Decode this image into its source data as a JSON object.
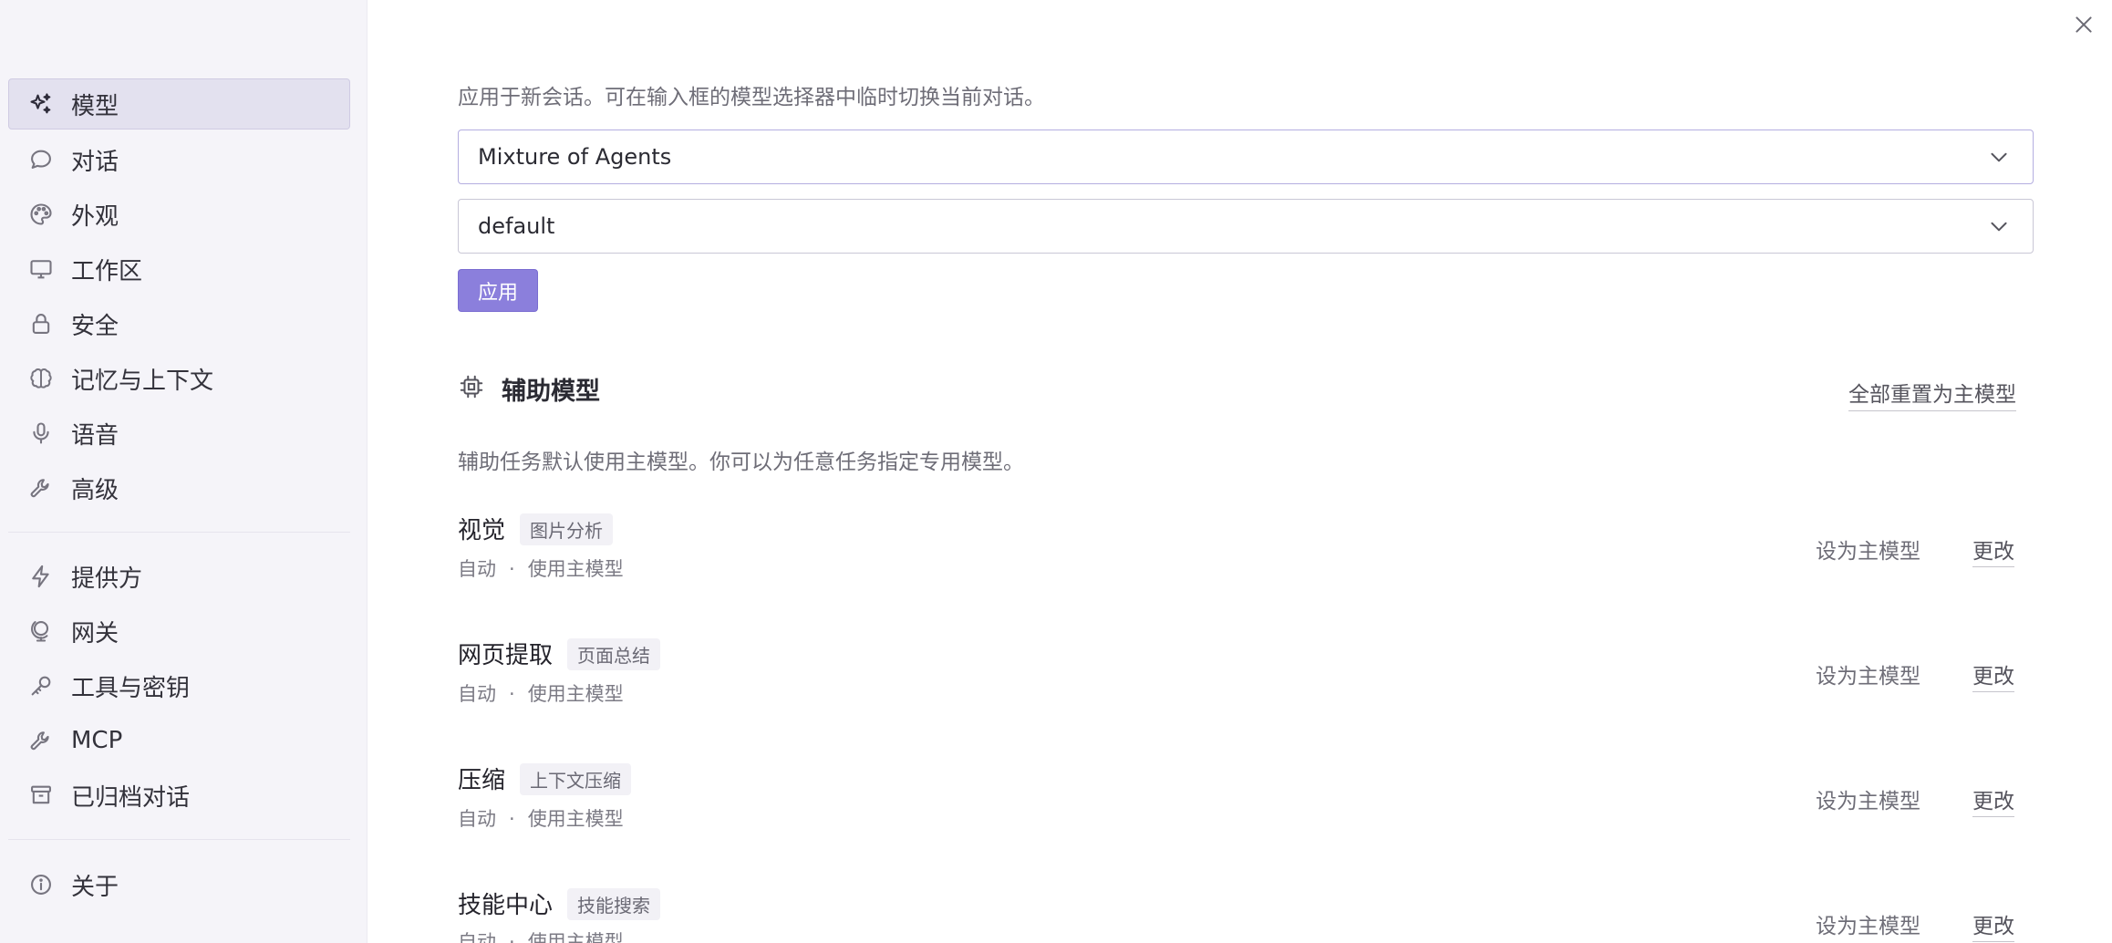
{
  "sidebar": {
    "items": [
      {
        "label": "模型",
        "icon": "sparkles-icon"
      },
      {
        "label": "对话",
        "icon": "chat-bubble-icon"
      },
      {
        "label": "外观",
        "icon": "palette-icon"
      },
      {
        "label": "工作区",
        "icon": "monitor-icon"
      },
      {
        "label": "安全",
        "icon": "lock-icon"
      },
      {
        "label": "记忆与上下文",
        "icon": "brain-icon"
      },
      {
        "label": "语音",
        "icon": "microphone-icon"
      },
      {
        "label": "高级",
        "icon": "wrench-icon"
      },
      {
        "label": "提供方",
        "icon": "lightning-icon"
      },
      {
        "label": "网关",
        "icon": "globe-icon"
      },
      {
        "label": "工具与密钥",
        "icon": "key-icon"
      },
      {
        "label": "MCP",
        "icon": "wrench-icon"
      },
      {
        "label": "已归档对话",
        "icon": "archive-icon"
      },
      {
        "label": "关于",
        "icon": "info-icon"
      }
    ],
    "active": "模型"
  },
  "main": {
    "description": "应用于新会话。可在输入框的模型选择器中临时切换当前对话。",
    "model_select": {
      "value": "Mixture of Agents"
    },
    "profile_select": {
      "value": "default"
    },
    "apply_label": "应用",
    "aux": {
      "title": "辅助模型",
      "reset_label": "全部重置为主模型",
      "description": "辅助任务默认使用主模型。你可以为任意任务指定专用模型。",
      "tasks": [
        {
          "name": "视觉",
          "tag": "图片分析",
          "status": "自动",
          "sep": "·",
          "model": "使用主模型",
          "set_main": "设为主模型",
          "change": "更改"
        },
        {
          "name": "网页提取",
          "tag": "页面总结",
          "status": "自动",
          "sep": "·",
          "model": "使用主模型",
          "set_main": "设为主模型",
          "change": "更改"
        },
        {
          "name": "压缩",
          "tag": "上下文压缩",
          "status": "自动",
          "sep": "·",
          "model": "使用主模型",
          "set_main": "设为主模型",
          "change": "更改"
        },
        {
          "name": "技能中心",
          "tag": "技能搜索",
          "status": "自动",
          "sep": "·",
          "model": "使用主模型",
          "set_main": "设为主模型",
          "change": "更改"
        }
      ]
    }
  },
  "colors": {
    "accent": "#8b7fdc",
    "sidebar_bg": "#f5f4f9",
    "active_item_bg": "#e3e1ef"
  }
}
